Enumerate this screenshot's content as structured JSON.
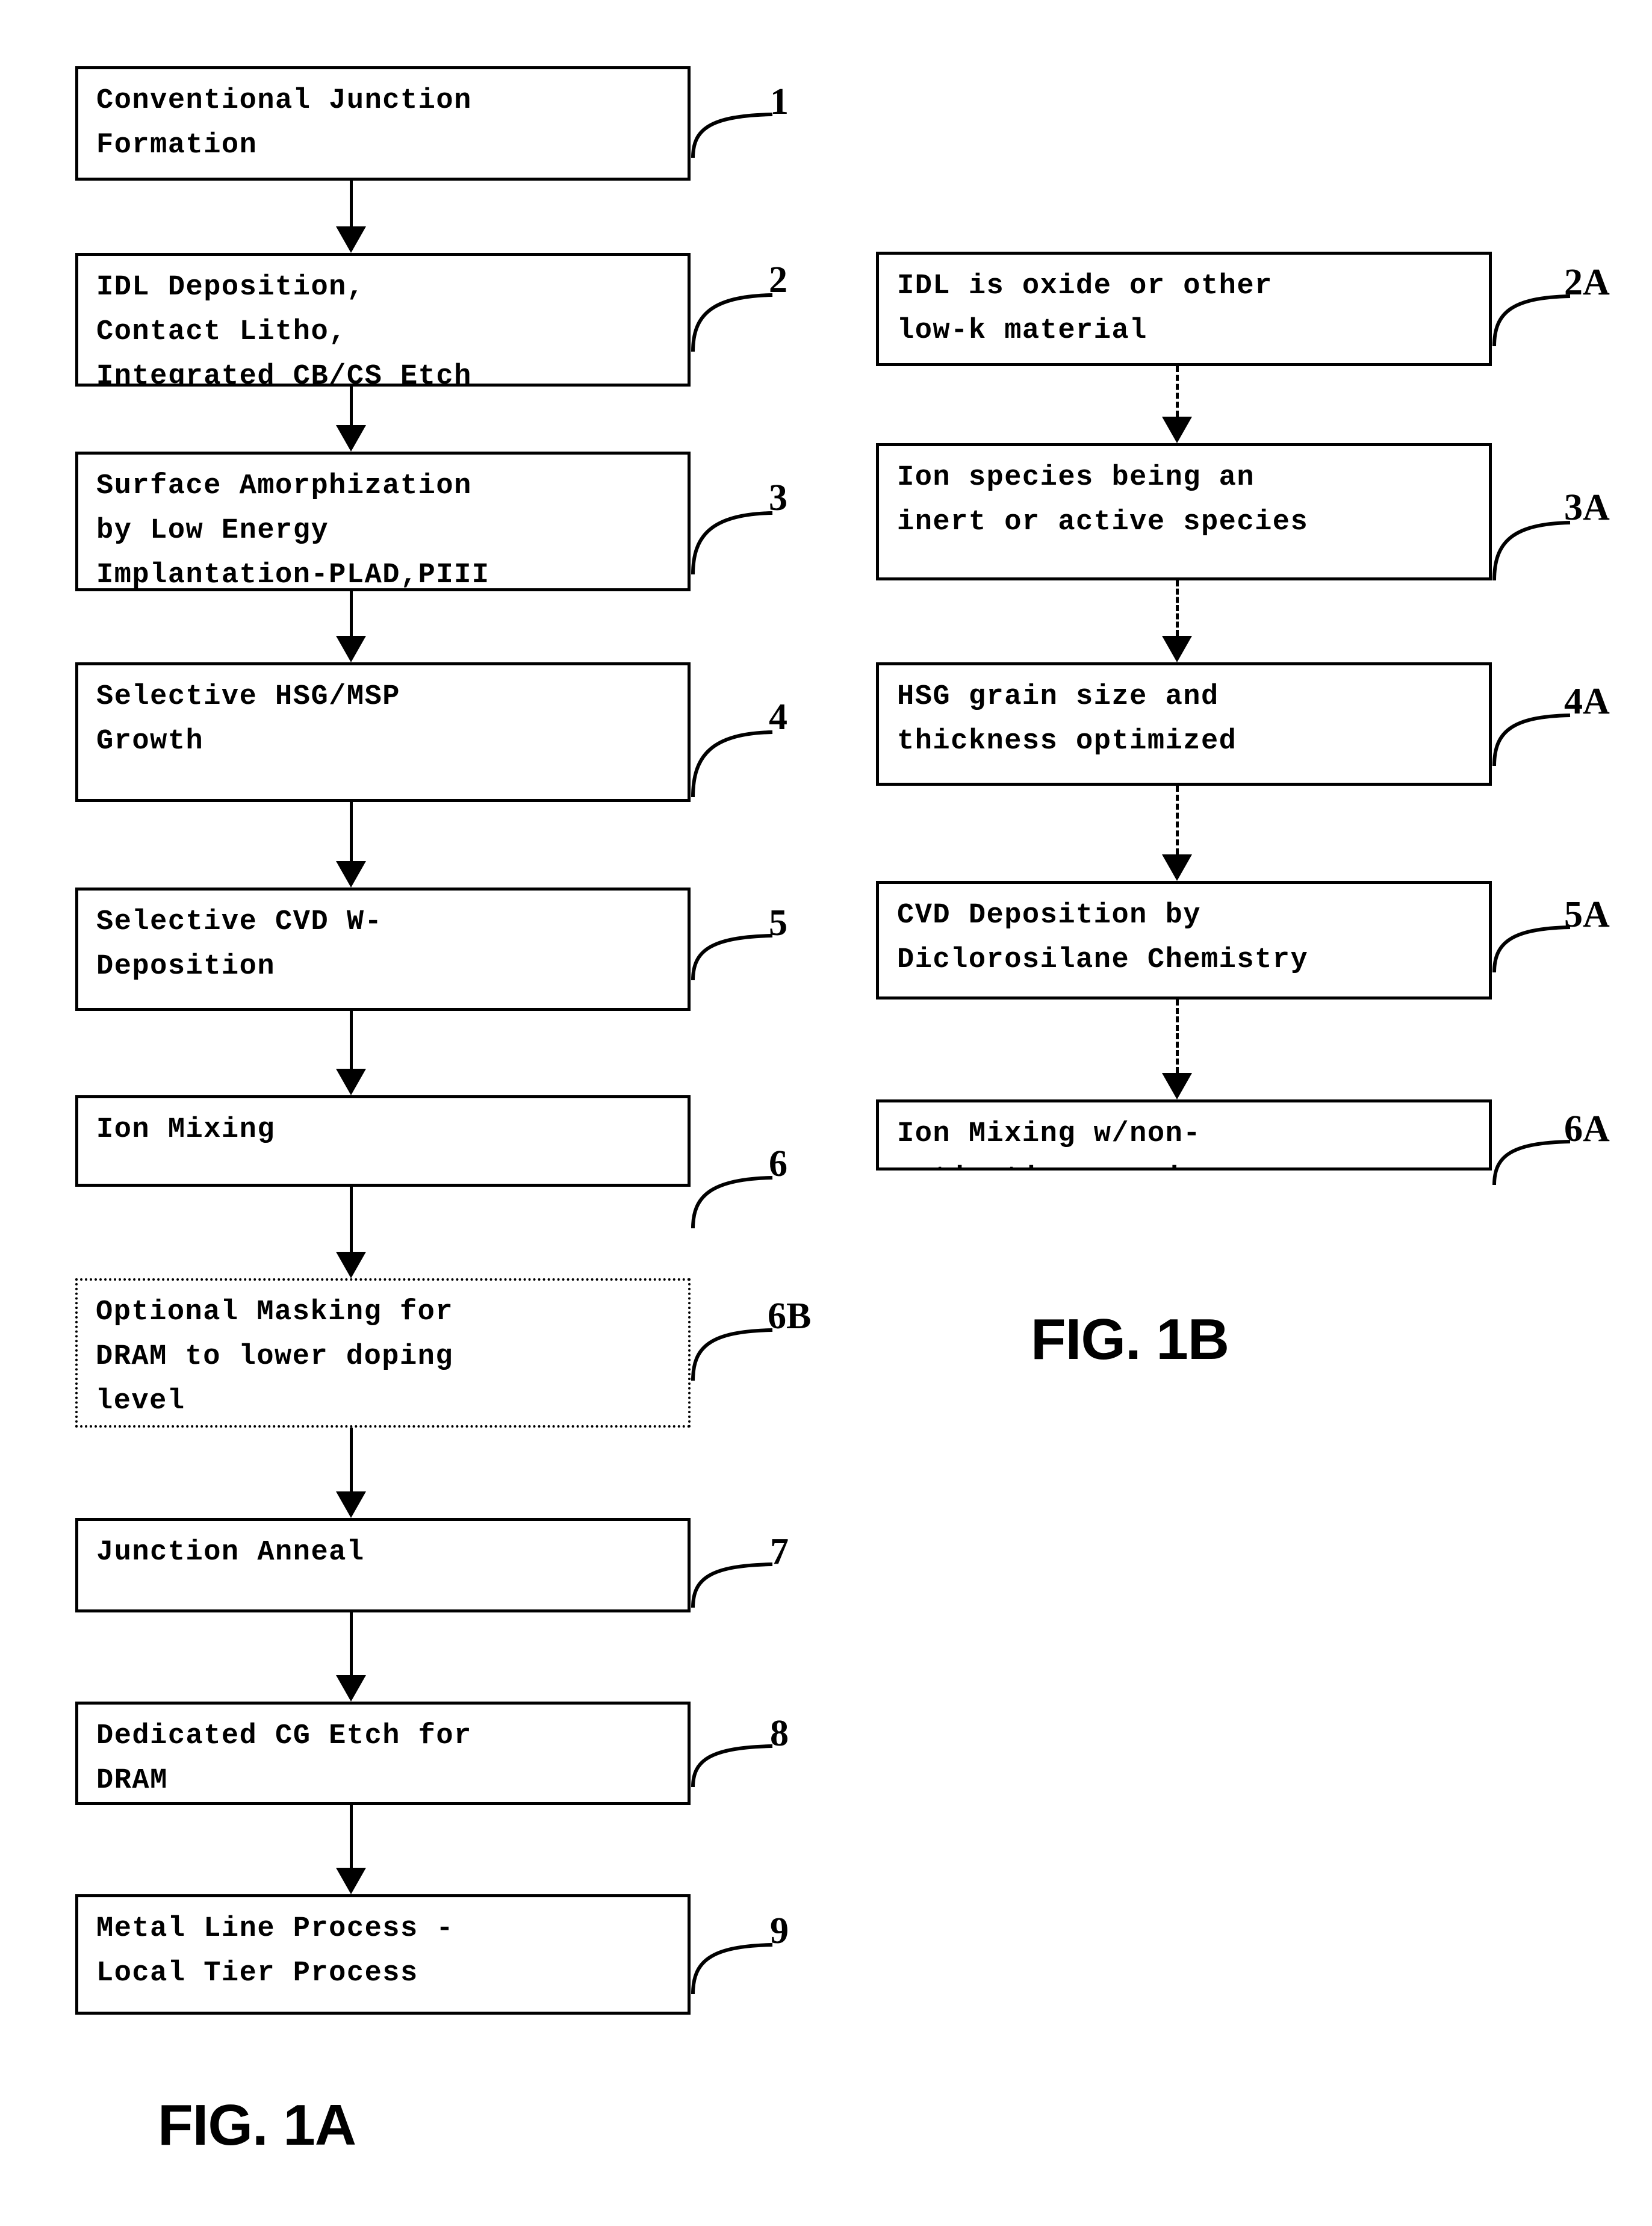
{
  "figure_a": {
    "caption": "FIG. 1A",
    "steps": [
      {
        "ref": "1",
        "text": "Conventional Junction\nFormation"
      },
      {
        "ref": "2",
        "text": "IDL Deposition,\nContact Litho,\nIntegrated CB/CS Etch"
      },
      {
        "ref": "3",
        "text": "Surface Amorphization\nby Low Energy\nImplantation-PLAD,PIII"
      },
      {
        "ref": "4",
        "text": "Selective HSG/MSP\nGrowth"
      },
      {
        "ref": "5",
        "text": "Selective CVD W-\nDeposition"
      },
      {
        "ref": "6",
        "text": "Ion Mixing"
      },
      {
        "ref": "6B",
        "text": "Optional Masking for\nDRAM to lower doping\nlevel"
      },
      {
        "ref": "7",
        "text": "Junction Anneal"
      },
      {
        "ref": "8",
        "text": "Dedicated CG Etch for\nDRAM"
      },
      {
        "ref": "9",
        "text": "Metal Line Process -\nLocal Tier Process"
      }
    ]
  },
  "figure_b": {
    "caption": "FIG. 1B",
    "steps": [
      {
        "ref": "2A",
        "text": "IDL is oxide or other\nlow-k material"
      },
      {
        "ref": "3A",
        "text": "Ion species being an\ninert or active species"
      },
      {
        "ref": "4A",
        "text": "HSG grain size and\nthickness optimized"
      },
      {
        "ref": "5A",
        "text": "CVD Deposition by\nDiclorosilane Chemistry"
      },
      {
        "ref": "6A",
        "text": "Ion Mixing w/non-\nactivating species"
      }
    ]
  }
}
